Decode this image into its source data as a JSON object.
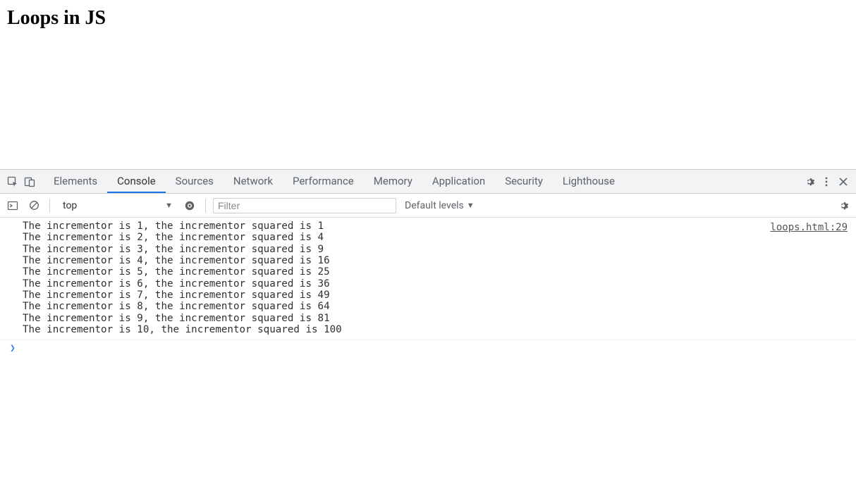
{
  "page": {
    "title": "Loops in JS"
  },
  "devtools": {
    "tabs": [
      {
        "label": "Elements"
      },
      {
        "label": "Console"
      },
      {
        "label": "Sources"
      },
      {
        "label": "Network"
      },
      {
        "label": "Performance"
      },
      {
        "label": "Memory"
      },
      {
        "label": "Application"
      },
      {
        "label": "Security"
      },
      {
        "label": "Lighthouse"
      }
    ],
    "active_tab": "Console",
    "toolbar": {
      "context": "top",
      "filter_placeholder": "Filter",
      "levels": "Default levels"
    },
    "console": {
      "source_link": "loops.html:29",
      "lines": [
        "The incrementor is 1, the incrementor squared is 1",
        "The incrementor is 2, the incrementor squared is 4",
        "The incrementor is 3, the incrementor squared is 9",
        "The incrementor is 4, the incrementor squared is 16",
        "The incrementor is 5, the incrementor squared is 25",
        "The incrementor is 6, the incrementor squared is 36",
        "The incrementor is 7, the incrementor squared is 49",
        "The incrementor is 8, the incrementor squared is 64",
        "The incrementor is 9, the incrementor squared is 81",
        "The incrementor is 10, the incrementor squared is 100"
      ]
    }
  }
}
